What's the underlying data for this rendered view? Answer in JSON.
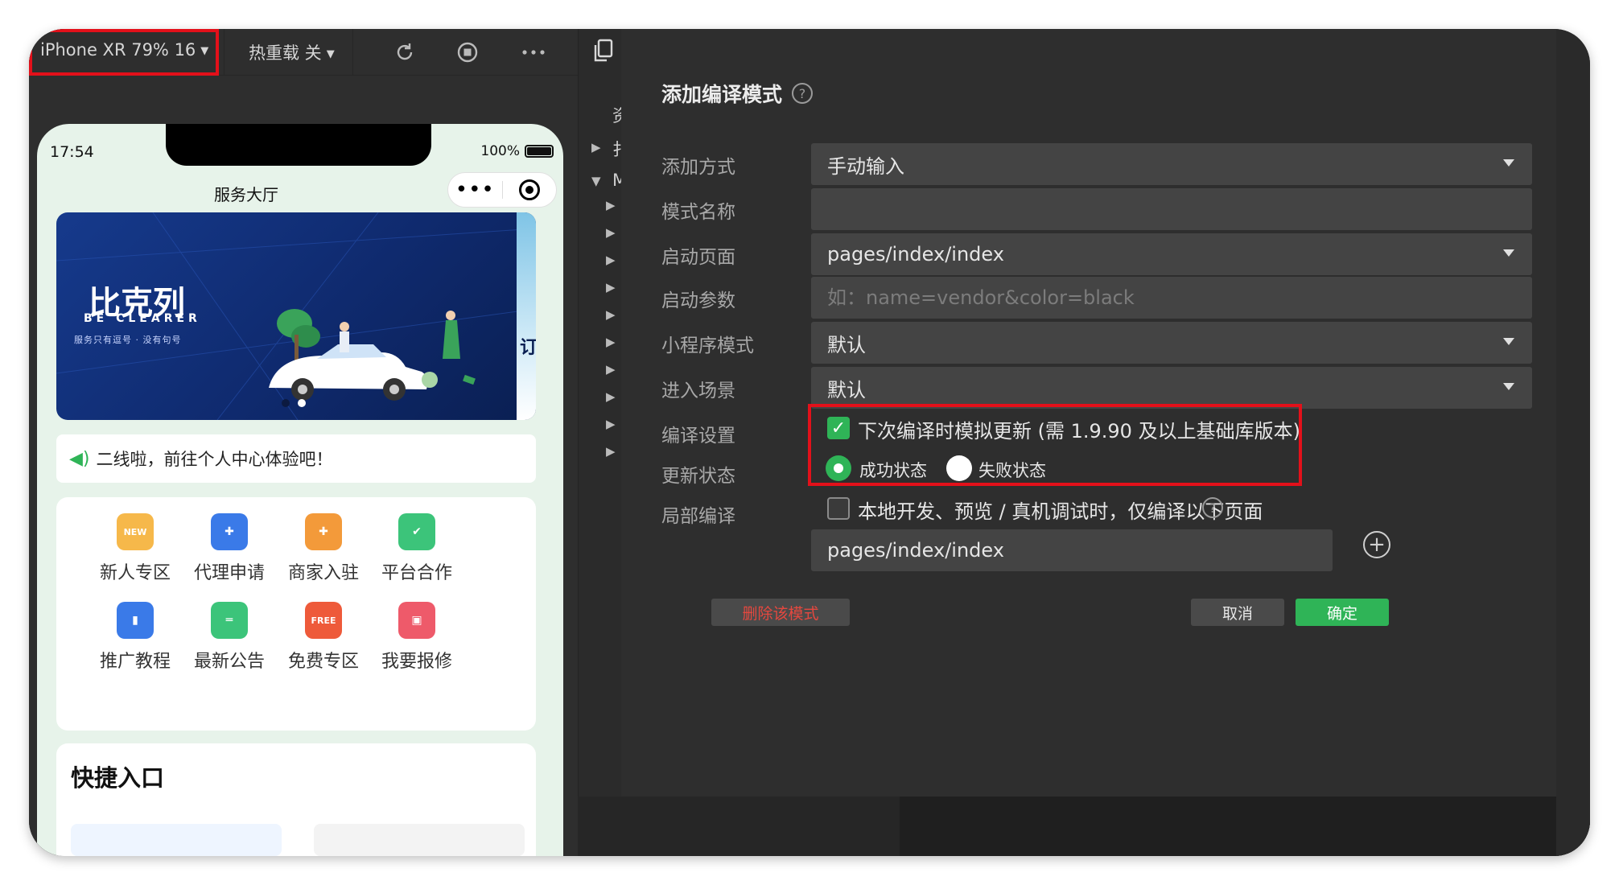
{
  "simulator": {
    "device_label": "iPhone XR 79% 16",
    "hot_reload_label": "热重载 关",
    "toolbar_icons": [
      "refresh-icon",
      "stop-icon",
      "more-icon"
    ]
  },
  "phone": {
    "status_time": "17:54",
    "battery": "100%",
    "page_title": "服务大厅",
    "capsule_more": "•••",
    "banner": {
      "title": "比克列",
      "subtitle": "BE CLEARER",
      "tagline": "服务只有逗号 · 没有句号",
      "peek_char": "订"
    },
    "notice_text": "二线啦，前往个人中心体验吧！",
    "grid_items": [
      {
        "label": "新人专区",
        "icon": "new-crown-icon",
        "color": "#f6b84a",
        "badge": "NEW"
      },
      {
        "label": "代理申请",
        "icon": "briefcase-icon",
        "color": "#3a7ae8",
        "badge": "✚"
      },
      {
        "label": "商家入驻",
        "icon": "shop-icon",
        "color": "#f39a3a",
        "badge": "✚"
      },
      {
        "label": "平台合作",
        "icon": "handshake-icon",
        "color": "#3cc47a",
        "badge": "✔"
      },
      {
        "label": "推广教程",
        "icon": "book-icon",
        "color": "#3a7ae8",
        "badge": "▮"
      },
      {
        "label": "最新公告",
        "icon": "announcement-icon",
        "color": "#3cc47a",
        "badge": "═"
      },
      {
        "label": "免费专区",
        "icon": "free-icon",
        "color": "#ee5a3a",
        "badge": "FREE"
      },
      {
        "label": "我要报修",
        "icon": "repair-icon",
        "color": "#ee5a6a",
        "badge": "▣"
      }
    ],
    "quick_title": "快捷入口"
  },
  "mid_panel": {
    "rows": [
      "资",
      "扌",
      "M"
    ]
  },
  "dialog": {
    "title": "添加编译模式",
    "labels": {
      "add_method": "添加方式",
      "mode_name": "模式名称",
      "start_page": "启动页面",
      "start_params": "启动参数",
      "mp_mode": "小程序模式",
      "scene": "进入场景",
      "compile_settings": "编译设置",
      "update_status": "更新状态",
      "partial_compile": "局部编译"
    },
    "values": {
      "add_method": "手动输入",
      "mode_name": "",
      "start_page": "pages/index/index",
      "start_params_placeholder": "如：name=vendor&color=black",
      "mp_mode": "默认",
      "scene": "默认",
      "partial_page": "pages/index/index"
    },
    "simulate_update_label": "下次编译时模拟更新 (需 1.9.90 及以上基础库版本)",
    "simulate_update_checked": true,
    "status_success": "成功状态",
    "status_fail": "失败状态",
    "partial_compile_label": "本地开发、预览 / 真机调试时，仅编译以下页面",
    "partial_compile_checked": false,
    "buttons": {
      "delete": "删除该模式",
      "cancel": "取消",
      "ok": "确定"
    }
  },
  "colors": {
    "accent_green": "#2fb457",
    "highlight_red": "#e3101a",
    "danger_text": "#e5483f"
  }
}
